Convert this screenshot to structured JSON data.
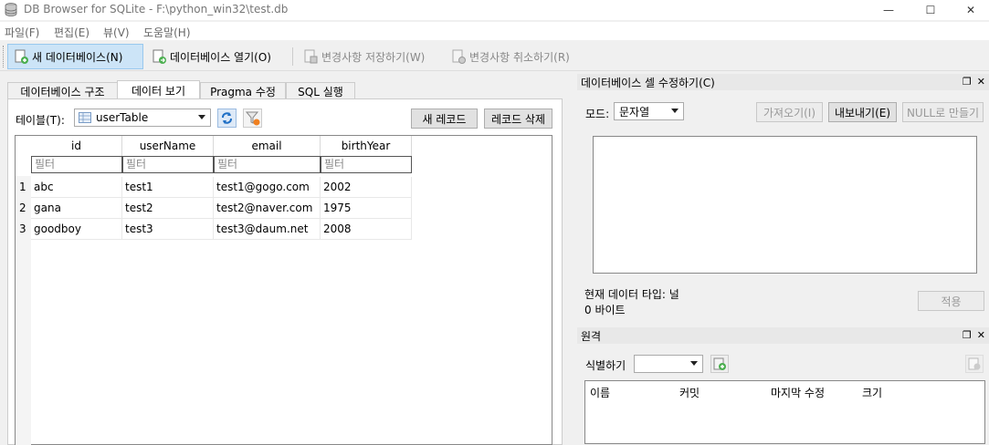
{
  "window": {
    "title": "DB Browser for SQLite - F:\\python_win32\\test.db",
    "minimize": "—",
    "maximize": "☐",
    "close": "✕"
  },
  "menu": {
    "items": [
      "파일(F)",
      "편집(E)",
      "뷰(V)",
      "도움말(H)"
    ]
  },
  "toolbar": {
    "new_db": "새 데이터베이스(N)",
    "open_db": "데이터베이스 열기(O)",
    "write_changes": "변경사항 저장하기(W)",
    "revert_changes": "변경사항 취소하기(R)"
  },
  "tabs": [
    "데이터베이스 구조",
    "데이터 보기",
    "Pragma 수정",
    "SQL 실행"
  ],
  "browse": {
    "table_label": "테이블(T):",
    "table_selected": "userTable",
    "new_record": "새 레코드",
    "delete_record": "레코드 삭제",
    "columns": [
      "id",
      "userName",
      "email",
      "birthYear"
    ],
    "filter_placeholder": "필터",
    "rows": [
      {
        "num": "1",
        "cells": [
          "abc",
          "test1",
          "test1@gogo.com",
          "2002"
        ]
      },
      {
        "num": "2",
        "cells": [
          "gana",
          "test2",
          "test2@naver.com",
          "1975"
        ]
      },
      {
        "num": "3",
        "cells": [
          "goodboy",
          "test3",
          "test3@daum.net",
          "2008"
        ]
      }
    ]
  },
  "edit_cell": {
    "title": "데이터베이스 셀 수정하기(C)",
    "mode_label": "모드:",
    "mode_value": "문자열",
    "import": "가져오기(I)",
    "export": "내보내기(E)",
    "set_null": "NULL로 만들기",
    "type_info": "현재 데이터 타입: 널",
    "size_info": "0 바이트",
    "apply": "적용"
  },
  "remote": {
    "title": "원격",
    "identity_label": "식별하기",
    "columns": [
      "이름",
      "커밋",
      "마지막 수정",
      "크기"
    ]
  },
  "colors": {
    "accent": "#cce4f7",
    "dock_header": "#e8e8e8",
    "background": "#f0f0f0"
  }
}
